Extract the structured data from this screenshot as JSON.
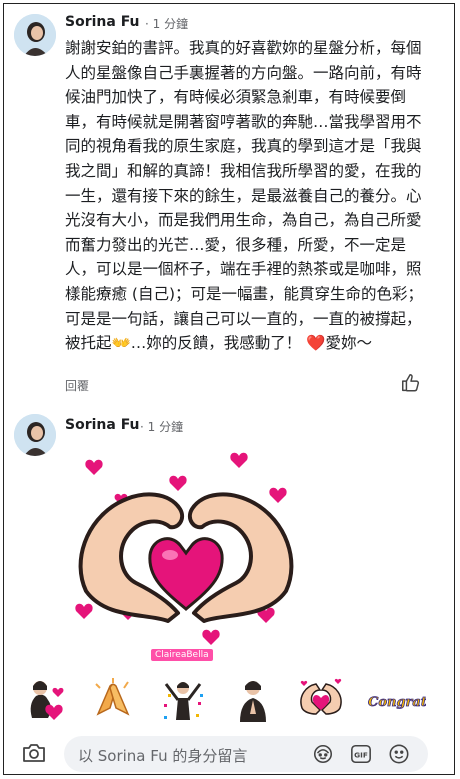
{
  "comment1": {
    "author": "Sorina Fu",
    "time": "· 1 分鐘",
    "body": "謝謝安鉑的書評。我真的好喜歡妳的星盤分析，每個人的星盤像自己手裏握著的方向盤。一路向前，有時候油門加快了，有時候必須緊急剎車，有時候要倒車，有時候就是開著窗哼著歌的奔馳…當我學習用不同的視角看我的原生家庭，我真的學到這才是「我與我之間」和解的真諦！我相信我所學習的愛，在我的一生，還有接下來的餘生，是最滋養自己的養分。心光沒有大小，而是我們用生命，為自己，為自己所愛而奮力發出的光芒…愛，很多種，所愛，不一定是人，可以是一個杯子，端在手裡的熱茶或是咖啡，照樣能療癒 (自己)；可是一幅畫，能貫穿生命的色彩；可是是一句話，讓自己可以一直的，一直的被撐起，被托起👐…妳的反饋，我感動了！ ❤️愛妳～",
    "reply_label": "回覆"
  },
  "comment2": {
    "author": "Sorina Fu",
    "time": "· 1 分鐘",
    "sticker_watermark": "ClaireaBella"
  },
  "sticker_tray": {
    "items": [
      "heart-hug-sticker",
      "clapping-hands-sticker",
      "celebration-sticker",
      "prayer-sticker",
      "heart-hands-sticker",
      "congrats-sticker"
    ],
    "congrats_text": "Congrats!"
  },
  "composer": {
    "placeholder": "以 Sorina Fu 的身分留言"
  },
  "colors": {
    "heart_pink": "#e5147a",
    "skin": "#f5cdb0",
    "muted": "#65676b",
    "composer_bg": "#f0f2f5"
  }
}
